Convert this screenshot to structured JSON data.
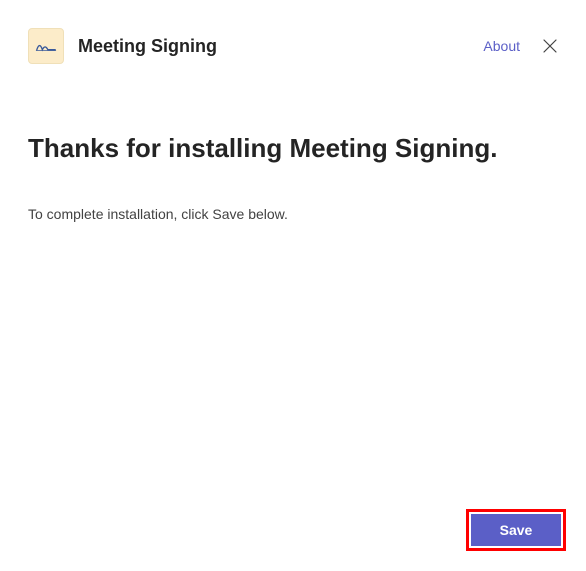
{
  "header": {
    "app_title": "Meeting Signing",
    "about_label": "About"
  },
  "content": {
    "heading": "Thanks for installing Meeting Signing.",
    "body": "To complete installation, click Save below."
  },
  "footer": {
    "save_label": "Save"
  },
  "colors": {
    "accent": "#5b5fc7",
    "highlight_border": "#ff0000",
    "icon_bg": "#fcecc9"
  }
}
